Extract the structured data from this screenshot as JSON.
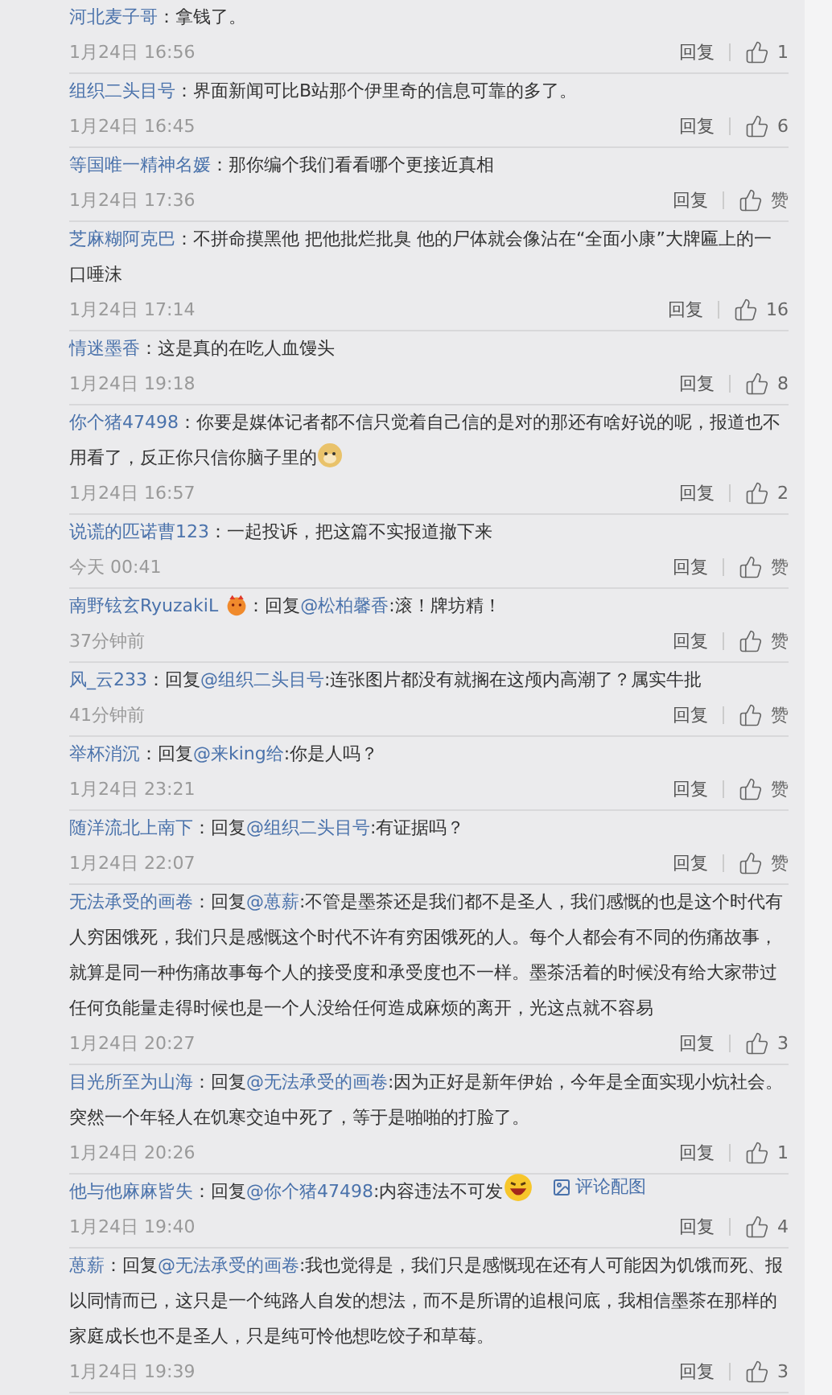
{
  "comments": [
    {
      "author": "河北麦子哥",
      "body": [
        {
          "kind": "text",
          "text": "：拿钱了。"
        }
      ],
      "time": "1月24日 16:56",
      "reply": "回复",
      "likes": "1"
    },
    {
      "author": "组织二头目号",
      "body": [
        {
          "kind": "text",
          "text": "：界面新闻可比B站那个伊里奇的信息可靠的多了。"
        }
      ],
      "time": "1月24日 16:45",
      "reply": "回复",
      "likes": "6"
    },
    {
      "author": "等国唯一精神名媛",
      "body": [
        {
          "kind": "text",
          "text": "：那你编个我们看看哪个更接近真相"
        }
      ],
      "time": "1月24日 17:36",
      "reply": "回复",
      "likes": "赞"
    },
    {
      "author": "芝麻糊阿克巴",
      "body": [
        {
          "kind": "text",
          "text": "：不拼命摸黑他 把他批烂批臭 他的尸体就会像沾在“全面小康”大牌匾上的一口唾沫"
        }
      ],
      "time": "1月24日 17:14",
      "reply": "回复",
      "likes": "16"
    },
    {
      "author": "情迷墨香",
      "body": [
        {
          "kind": "text",
          "text": "：这是真的在吃人血馒头"
        }
      ],
      "time": "1月24日 19:18",
      "reply": "回复",
      "likes": "8"
    },
    {
      "author": "你个猪47498",
      "body": [
        {
          "kind": "text",
          "text": "：你要是媒体记者都不信只觉着自己信的是对的那还有啥好说的呢，报道也不用看了，反正你只信你脑子里的"
        },
        {
          "kind": "doge"
        }
      ],
      "time": "1月24日 16:57",
      "reply": "回复",
      "likes": "2"
    },
    {
      "author": "说谎的匹诺曹123",
      "body": [
        {
          "kind": "text",
          "text": "：一起投诉，把这篇不实报道撤下来"
        }
      ],
      "time": "今天 00:41",
      "reply": "回复",
      "likes": "赞"
    },
    {
      "author": "南野铉玄RyuzakiL",
      "body": [
        {
          "kind": "badge"
        },
        {
          "kind": "text",
          "text": "：回复"
        },
        {
          "kind": "mention",
          "text": "@松柏馨香"
        },
        {
          "kind": "text",
          "text": ":滚！牌坊精！"
        }
      ],
      "time": "37分钟前",
      "reply": "回复",
      "likes": "赞"
    },
    {
      "author": "风_云233",
      "body": [
        {
          "kind": "text",
          "text": "：回复"
        },
        {
          "kind": "mention",
          "text": "@组织二头目号"
        },
        {
          "kind": "text",
          "text": ":连张图片都没有就搁在这颅内高潮了？属实牛批"
        }
      ],
      "time": "41分钟前",
      "reply": "回复",
      "likes": "赞"
    },
    {
      "author": "举杯消沉",
      "body": [
        {
          "kind": "text",
          "text": "：回复"
        },
        {
          "kind": "mention",
          "text": "@来king给"
        },
        {
          "kind": "text",
          "text": ":你是人吗？"
        }
      ],
      "time": "1月24日 23:21",
      "reply": "回复",
      "likes": "赞"
    },
    {
      "author": "随洋流北上南下",
      "body": [
        {
          "kind": "text",
          "text": "：回复"
        },
        {
          "kind": "mention",
          "text": "@组织二头目号"
        },
        {
          "kind": "text",
          "text": ":有证据吗？"
        }
      ],
      "time": "1月24日 22:07",
      "reply": "回复",
      "likes": "赞"
    },
    {
      "author": "无法承受的画卷",
      "body": [
        {
          "kind": "text",
          "text": "：回复"
        },
        {
          "kind": "mention",
          "text": "@葸薪"
        },
        {
          "kind": "text",
          "text": ":不管是墨茶还是我们都不是圣人，我们感慨的也是这个时代有人穷困饿死，我们只是感慨这个时代不许有穷困饿死的人。每个人都会有不同的伤痛故事，就算是同一种伤痛故事每个人的接受度和承受度也不一样。墨茶活着的时候没有给大家带过任何负能量走得时候也是一个人没给任何造成麻烦的离开，光这点就不容易"
        }
      ],
      "time": "1月24日 20:27",
      "reply": "回复",
      "likes": "3"
    },
    {
      "author": "目光所至为山海",
      "body": [
        {
          "kind": "text",
          "text": "：回复"
        },
        {
          "kind": "mention",
          "text": "@无法承受的画卷"
        },
        {
          "kind": "text",
          "text": ":因为正好是新年伊始，今年是全面实现小炕社会。突然一个年轻人在饥寒交迫中死了，等于是啪啪的打脸了。"
        }
      ],
      "time": "1月24日 20:26",
      "reply": "回复",
      "likes": "1"
    },
    {
      "author": "他与他麻麻皆失",
      "body": [
        {
          "kind": "text",
          "text": "：回复"
        },
        {
          "kind": "mention",
          "text": "@你个猪47498"
        },
        {
          "kind": "text",
          "text": ":内容违法不可发"
        },
        {
          "kind": "laugh"
        },
        {
          "kind": "link",
          "text": "评论配图"
        }
      ],
      "time": "1月24日 19:40",
      "reply": "回复",
      "likes": "4"
    },
    {
      "author": "葸薪",
      "body": [
        {
          "kind": "text",
          "text": "：回复"
        },
        {
          "kind": "mention",
          "text": "@无法承受的画卷"
        },
        {
          "kind": "text",
          "text": ":我也觉得是，我们只是感慨现在还有人可能因为饥饿而死、报以同情而已，这只是一个纯路人自发的想法，而不是所谓的追根问底，我相信墨茶在那样的家庭成长也不是圣人，只是纯可怜他想吃饺子和草莓。"
        }
      ],
      "time": "1月24日 19:39",
      "reply": "回复",
      "likes": "3"
    }
  ]
}
